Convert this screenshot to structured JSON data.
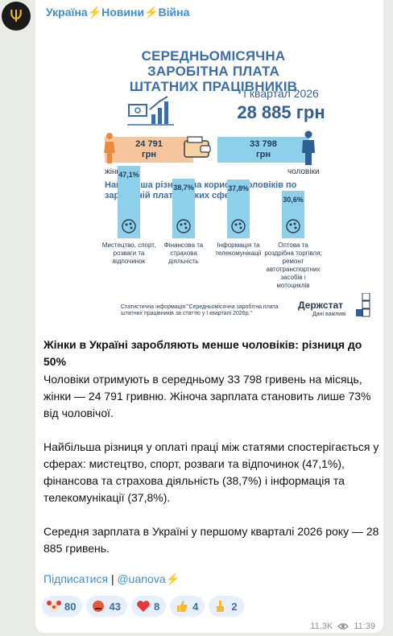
{
  "channel": {
    "title_parts": [
      "Україна",
      "Новини",
      "Війна"
    ]
  },
  "infographic": {
    "title": "СЕРЕДНЬОМІСЯЧНА ЗАРОБІТНА ПЛАТА ШТАТНИХ ПРАЦІВНИКІВ",
    "quarter": "І квартал 2026",
    "total": "28 885 грн",
    "women": {
      "value": "24 791",
      "unit": "грн",
      "label": "жінки"
    },
    "men": {
      "value": "33 798",
      "unit": "грн",
      "label": "чоловіки"
    },
    "subtitle": "Найбільша різниця на користь чоловіків по заробітній платі у таких сферах:",
    "sectors": [
      {
        "pct": "47,1%",
        "value": 47.1,
        "label": "Мистецтво, спорт, розваги та відпочинок"
      },
      {
        "pct": "38,7%",
        "value": 38.7,
        "label": "Фінансова та страхова діяльність"
      },
      {
        "pct": "37,8%",
        "value": 37.8,
        "label": "Інформація та телекомунікації"
      },
      {
        "pct": "30,6%",
        "value": 30.6,
        "label": "Оптова та роздрібна торгівля; ремонт автотранспортних засобів і мотоциклів"
      }
    ],
    "note": "Статистична інформація \"Середньомісячна заробітна плата штатних працівників за статтю у І кварталі 2026р.\"",
    "brand": "Держстат",
    "brand_sub": "Дані важливі"
  },
  "message": {
    "headline": "Жінки в Україні заробляють менше чоловіків: різниця до 50%",
    "p1": "Чоловіки отримують в середньому 33 798 гривень на місяць, жінки — 24 791 гривню. Жіноча зарплата становить лише 73% від чоловічої.",
    "p2": "Найбільша різниця у оплаті праці між статями спостерігається у сферах: мистецтво, спорт, розваги та відпочинок (47,1%), фінансова та страхова діяльність (38,7%) і інформація та телекомунікації (37,8%).",
    "p3": "Середня зарплата в Україні у першому кварталі 2026 року — 28 885 гривень."
  },
  "links": {
    "subscribe": "Підписатися",
    "separator": "|",
    "handle": "@uanova"
  },
  "reactions": [
    {
      "icon": "clown-face-icon",
      "count": "80"
    },
    {
      "icon": "angry-face-icon",
      "count": "43"
    },
    {
      "icon": "red-heart-icon",
      "count": "8"
    },
    {
      "icon": "thumbs-up-icon",
      "count": "4"
    },
    {
      "icon": "middle-finger-icon",
      "count": "2"
    }
  ],
  "meta": {
    "views": "11.3K",
    "time": "11:39"
  },
  "colors": {
    "link": "#3a8fd6",
    "accent_blue": "#3b6ea8",
    "men_bar": "#8ecfe9",
    "women_bar": "#f5c69d",
    "bolt": "#f2b705"
  }
}
